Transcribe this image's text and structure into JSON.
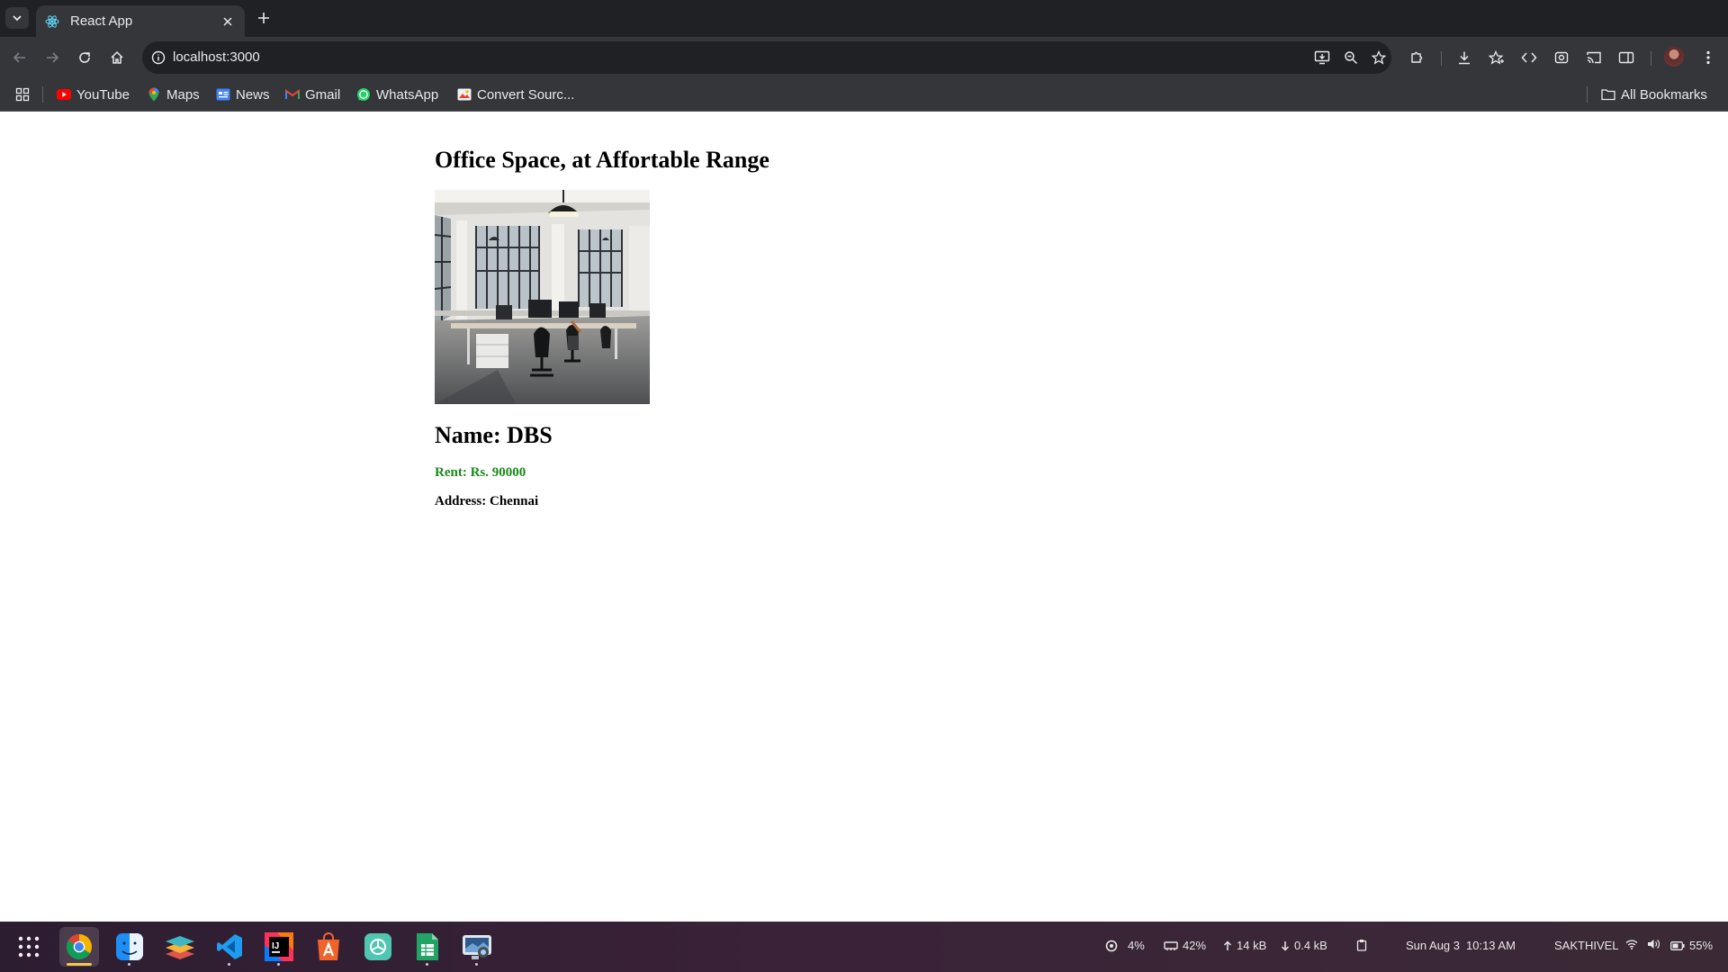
{
  "browser": {
    "tab": {
      "title": "React App"
    },
    "address_bar": {
      "url": "localhost:3000"
    },
    "bookmarks": [
      {
        "label": "YouTube",
        "icon": "youtube-icon"
      },
      {
        "label": "Maps",
        "icon": "maps-pin-icon"
      },
      {
        "label": "News",
        "icon": "google-news-icon"
      },
      {
        "label": "Gmail",
        "icon": "gmail-icon"
      },
      {
        "label": "WhatsApp",
        "icon": "whatsapp-icon"
      },
      {
        "label": "Convert Sourc...",
        "icon": "bookmark-favicon"
      }
    ],
    "all_bookmarks_label": "All Bookmarks"
  },
  "page": {
    "heading": "Office Space, at Affortable Range",
    "office": {
      "name_label": "Name: DBS",
      "rent_label": "Rent: Rs. 90000",
      "address_label": "Address: Chennai",
      "rent_color": "#1a8a1a"
    }
  },
  "taskbar": {
    "apps": [
      "app-launcher",
      "chrome",
      "finder",
      "layers",
      "vscode",
      "intellij",
      "app-store",
      "chatgpt",
      "spreadsheet",
      "screen-capture"
    ],
    "cpu": "4%",
    "memory": "42%",
    "upload": "14 kB",
    "download": "0.4 kB",
    "date": "Sun Aug 3",
    "time": "10:13 AM",
    "user": "SAKTHIVEL",
    "battery": "55%"
  }
}
